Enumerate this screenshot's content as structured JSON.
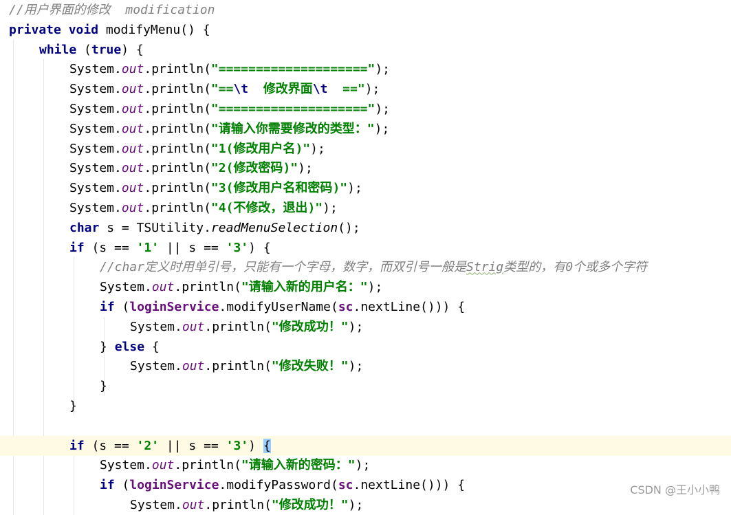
{
  "editor": {
    "lines": [
      {
        "indent": 0,
        "tokens": [
          {
            "t": "//用户界面的修改  modification",
            "c": "comment"
          }
        ]
      },
      {
        "indent": 0,
        "tokens": [
          {
            "t": "private void",
            "c": "kw"
          },
          {
            "t": " modifyMenu() {",
            "c": ""
          }
        ]
      },
      {
        "indent": 1,
        "tokens": [
          {
            "t": "while",
            "c": "kw"
          },
          {
            "t": " (",
            "c": ""
          },
          {
            "t": "true",
            "c": "kw"
          },
          {
            "t": ") {",
            "c": ""
          }
        ]
      },
      {
        "indent": 2,
        "tokens": [
          {
            "t": "System.",
            "c": ""
          },
          {
            "t": "out",
            "c": "field"
          },
          {
            "t": ".println(",
            "c": ""
          },
          {
            "t": "\"====================\"",
            "c": "str"
          },
          {
            "t": ");",
            "c": ""
          }
        ]
      },
      {
        "indent": 2,
        "tokens": [
          {
            "t": "System.",
            "c": ""
          },
          {
            "t": "out",
            "c": "field"
          },
          {
            "t": ".println(",
            "c": ""
          },
          {
            "t": "\"==",
            "c": "str"
          },
          {
            "t": "\\t",
            "c": "esc"
          },
          {
            "t": "  修改界面",
            "c": "str"
          },
          {
            "t": "\\t",
            "c": "esc"
          },
          {
            "t": "  ==\"",
            "c": "str"
          },
          {
            "t": ");",
            "c": ""
          }
        ]
      },
      {
        "indent": 2,
        "tokens": [
          {
            "t": "System.",
            "c": ""
          },
          {
            "t": "out",
            "c": "field"
          },
          {
            "t": ".println(",
            "c": ""
          },
          {
            "t": "\"====================\"",
            "c": "str"
          },
          {
            "t": ");",
            "c": ""
          }
        ]
      },
      {
        "indent": 2,
        "tokens": [
          {
            "t": "System.",
            "c": ""
          },
          {
            "t": "out",
            "c": "field"
          },
          {
            "t": ".println(",
            "c": ""
          },
          {
            "t": "\"请输入你需要修改的类型：\"",
            "c": "str"
          },
          {
            "t": ");",
            "c": ""
          }
        ]
      },
      {
        "indent": 2,
        "tokens": [
          {
            "t": "System.",
            "c": ""
          },
          {
            "t": "out",
            "c": "field"
          },
          {
            "t": ".println(",
            "c": ""
          },
          {
            "t": "\"1(修改用户名)\"",
            "c": "str"
          },
          {
            "t": ");",
            "c": ""
          }
        ]
      },
      {
        "indent": 2,
        "tokens": [
          {
            "t": "System.",
            "c": ""
          },
          {
            "t": "out",
            "c": "field"
          },
          {
            "t": ".println(",
            "c": ""
          },
          {
            "t": "\"2(修改密码)\"",
            "c": "str"
          },
          {
            "t": ");",
            "c": ""
          }
        ]
      },
      {
        "indent": 2,
        "tokens": [
          {
            "t": "System.",
            "c": ""
          },
          {
            "t": "out",
            "c": "field"
          },
          {
            "t": ".println(",
            "c": ""
          },
          {
            "t": "\"3(修改用户名和密码)\"",
            "c": "str"
          },
          {
            "t": ");",
            "c": ""
          }
        ]
      },
      {
        "indent": 2,
        "tokens": [
          {
            "t": "System.",
            "c": ""
          },
          {
            "t": "out",
            "c": "field"
          },
          {
            "t": ".println(",
            "c": ""
          },
          {
            "t": "\"4(不修改，退出)\"",
            "c": "str"
          },
          {
            "t": ");",
            "c": ""
          }
        ]
      },
      {
        "indent": 2,
        "tokens": [
          {
            "t": "char",
            "c": "kw"
          },
          {
            "t": " s = TSUtility.",
            "c": ""
          },
          {
            "t": "readMenuSelection",
            "c": "static"
          },
          {
            "t": "();",
            "c": ""
          }
        ]
      },
      {
        "indent": 2,
        "tokens": [
          {
            "t": "if",
            "c": "kw"
          },
          {
            "t": " (s == ",
            "c": ""
          },
          {
            "t": "'1'",
            "c": "str"
          },
          {
            "t": " || s == ",
            "c": ""
          },
          {
            "t": "'3'",
            "c": "str"
          },
          {
            "t": ") {",
            "c": ""
          }
        ]
      },
      {
        "indent": 3,
        "tokens": [
          {
            "t": "//char定义时用单引号，只能有一个字母，数字，而双引号一般是",
            "c": "comment"
          },
          {
            "t": "Strig",
            "c": "comment typo"
          },
          {
            "t": "类型的，有0个或多个字符",
            "c": "comment"
          }
        ]
      },
      {
        "indent": 3,
        "tokens": [
          {
            "t": "System.",
            "c": ""
          },
          {
            "t": "out",
            "c": "field"
          },
          {
            "t": ".println(",
            "c": ""
          },
          {
            "t": "\"请输入新的用户名：\"",
            "c": "str"
          },
          {
            "t": ");",
            "c": ""
          }
        ]
      },
      {
        "indent": 3,
        "tokens": [
          {
            "t": "if",
            "c": "kw"
          },
          {
            "t": " (",
            "c": ""
          },
          {
            "t": "loginService",
            "c": "fieldref"
          },
          {
            "t": ".modifyUserName(",
            "c": ""
          },
          {
            "t": "sc",
            "c": "fieldref"
          },
          {
            "t": ".nextLine())) {",
            "c": ""
          }
        ]
      },
      {
        "indent": 4,
        "tokens": [
          {
            "t": "System.",
            "c": ""
          },
          {
            "t": "out",
            "c": "field"
          },
          {
            "t": ".println(",
            "c": ""
          },
          {
            "t": "\"修改成功！\"",
            "c": "str"
          },
          {
            "t": ");",
            "c": ""
          }
        ]
      },
      {
        "indent": 3,
        "tokens": [
          {
            "t": "} ",
            "c": ""
          },
          {
            "t": "else",
            "c": "kw"
          },
          {
            "t": " {",
            "c": ""
          }
        ]
      },
      {
        "indent": 4,
        "tokens": [
          {
            "t": "System.",
            "c": ""
          },
          {
            "t": "out",
            "c": "field"
          },
          {
            "t": ".println(",
            "c": ""
          },
          {
            "t": "\"修改失败！\"",
            "c": "str"
          },
          {
            "t": ");",
            "c": ""
          }
        ]
      },
      {
        "indent": 3,
        "tokens": [
          {
            "t": "}",
            "c": ""
          }
        ]
      },
      {
        "indent": 2,
        "tokens": [
          {
            "t": "}",
            "c": ""
          }
        ]
      },
      {
        "indent": 0,
        "tokens": []
      },
      {
        "indent": 2,
        "current": true,
        "tokens": [
          {
            "t": "if",
            "c": "kw"
          },
          {
            "t": " (s == ",
            "c": ""
          },
          {
            "t": "'2'",
            "c": "str"
          },
          {
            "t": " || s == ",
            "c": ""
          },
          {
            "t": "'3'",
            "c": "str"
          },
          {
            "t": ") ",
            "c": ""
          },
          {
            "t": "{",
            "c": "braceMatch"
          }
        ]
      },
      {
        "indent": 3,
        "tokens": [
          {
            "t": "System.",
            "c": ""
          },
          {
            "t": "out",
            "c": "field"
          },
          {
            "t": ".println(",
            "c": ""
          },
          {
            "t": "\"请输入新的密码：\"",
            "c": "str"
          },
          {
            "t": ");",
            "c": ""
          }
        ]
      },
      {
        "indent": 3,
        "tokens": [
          {
            "t": "if",
            "c": "kw"
          },
          {
            "t": " (",
            "c": ""
          },
          {
            "t": "loginService",
            "c": "fieldref"
          },
          {
            "t": ".modifyPassword(",
            "c": ""
          },
          {
            "t": "sc",
            "c": "fieldref"
          },
          {
            "t": ".nextLine())) {",
            "c": ""
          }
        ]
      },
      {
        "indent": 4,
        "tokens": [
          {
            "t": "System.",
            "c": ""
          },
          {
            "t": "out",
            "c": "field"
          },
          {
            "t": ".println(",
            "c": ""
          },
          {
            "t": "\"修改成功！\"",
            "c": "str"
          },
          {
            "t": ");",
            "c": ""
          }
        ]
      }
    ]
  },
  "watermark": "CSDN @王小小鸭"
}
